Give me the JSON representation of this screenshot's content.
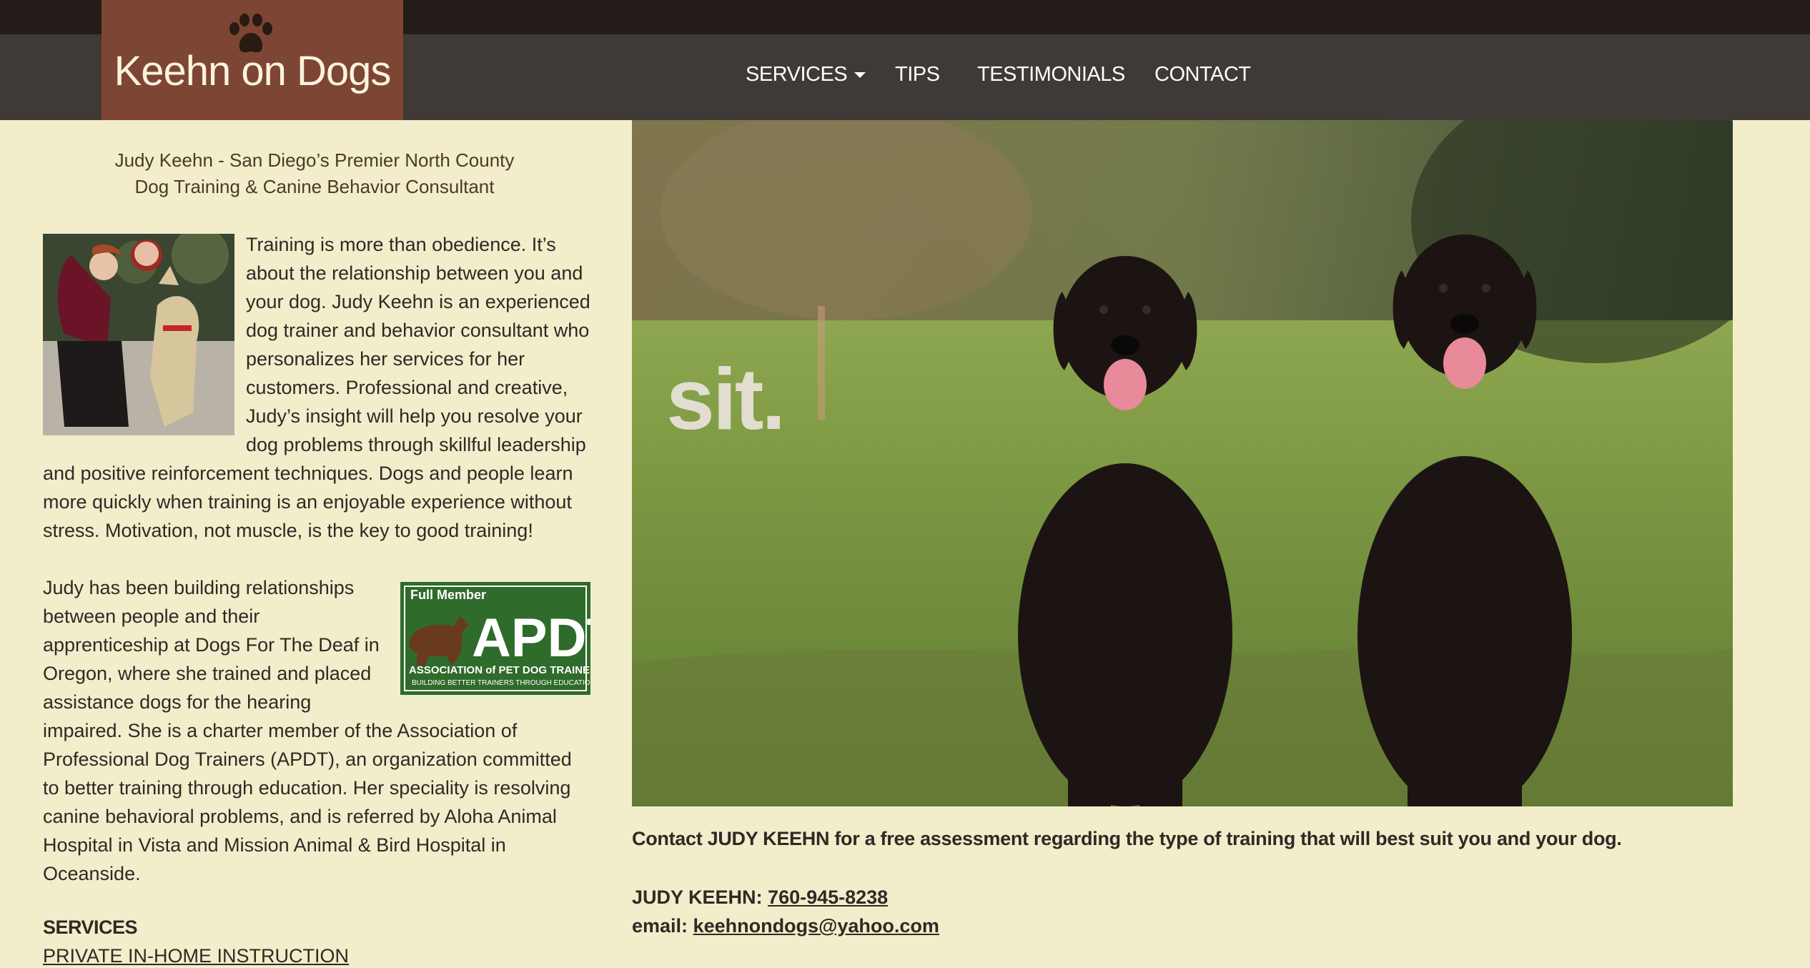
{
  "header": {
    "logo_text": "Keehn on Dogs",
    "logo_icon": "paw-icon",
    "nav": [
      {
        "label": "SERVICES",
        "has_dropdown": true
      },
      {
        "label": "TIPS"
      },
      {
        "label": "TESTIMONIALS"
      },
      {
        "label": "CONTACT"
      }
    ]
  },
  "tagline": {
    "line1": "Judy Keehn - San Diego’s Premier North County",
    "line2": "Dog Training & Canine Behavior Consultant"
  },
  "intro": {
    "para1": "Training is more than obedience. It’s about the relationship between you and your dog. Judy Keehn is an experienced dog trainer and behavior consultant who personalizes her services for her customers. Professional and creative, Judy’s insight will help you resolve your dog problems through skillful leadership and positive reinforcement techniques. Dogs and people learn more quickly when training is an enjoyable experience without stress. Motivation, not muscle, is the key to good training!",
    "para2": "Judy has been building relationships between people and their apprenticeship at Dogs For The Deaf in Oregon, where she trained and placed assistance dogs for the hearing impaired. She is a charter member of the Association of Professional Dog Trainers (APDT), an organization committed to better training through education. Her speciality is resolving canine behavioral problems, and is referred by Aloha Animal Hospital in Vista and Mission Animal & Bird Hospital in Oceanside."
  },
  "apdt_badge": {
    "top": "Full Member",
    "main": "APDT",
    "sub": "ASSOCIATION of PET DOG TRAINERS",
    "tag": "BUILDING BETTER TRAINERS THROUGH EDUCATION"
  },
  "services": {
    "heading": "SERVICES",
    "link": "PRIVATE IN-HOME INSTRUCTION"
  },
  "hero": {
    "overlay_text": "sit."
  },
  "contact": {
    "line": "Contact JUDY KEEHN for a free assessment regarding the type of training that will best suit you and your dog.",
    "phone_label": "JUDY KEEHN: ",
    "phone": "760-945-8238",
    "email_label": "email: ",
    "email": "keehnondogs@yahoo.com"
  },
  "colors": {
    "topbar": "#231c18",
    "navbar": "#3f3a35",
    "logo_bg": "#7d4634",
    "page_bg": "#f2edcb",
    "apdt_green": "#2f6b2a"
  }
}
